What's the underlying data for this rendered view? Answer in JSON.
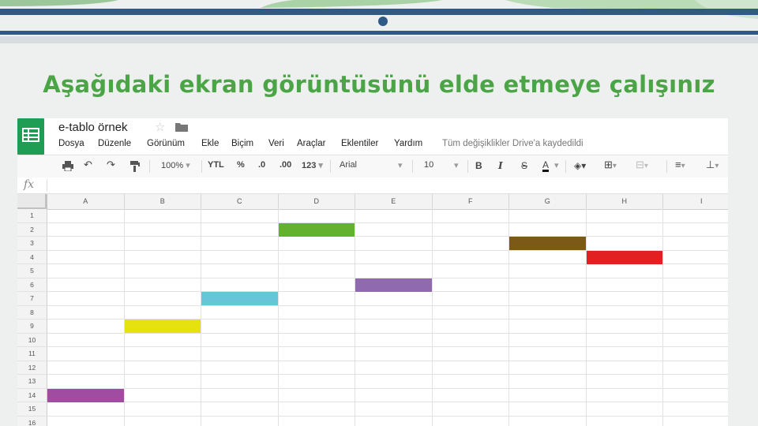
{
  "slide": {
    "title": "Aşağıdaki ekran görüntüsünü elde etmeye çalışınız"
  },
  "doc": {
    "title": "e-tablo örnek",
    "menu": [
      "Dosya",
      "Düzenle",
      "Görünüm",
      "Ekle",
      "Biçim",
      "Veri",
      "Araçlar",
      "Eklentiler",
      "Yardım"
    ],
    "saved_status": "Tüm değişiklikler Drive'a kaydedildi"
  },
  "toolbar": {
    "zoom": "100%",
    "currency": "YTL",
    "percent": "%",
    "dec_decrease": ".0",
    "dec_increase": ".00",
    "format_more": "123",
    "font": "Arial",
    "font_size": "10",
    "bold": "B",
    "italic": "I",
    "strike": "S",
    "text_color": "A"
  },
  "formula_bar": {
    "fx": "fx"
  },
  "grid": {
    "columns": [
      "A",
      "B",
      "C",
      "D",
      "E",
      "F",
      "G",
      "H",
      "I"
    ],
    "rows": [
      "1",
      "2",
      "3",
      "4",
      "5",
      "6",
      "7",
      "8",
      "9",
      "10",
      "11",
      "12",
      "13",
      "14",
      "15",
      "16"
    ],
    "colored_cells": [
      {
        "cell": "D2",
        "color": "#63b22f"
      },
      {
        "cell": "G3",
        "color": "#7b5a17"
      },
      {
        "cell": "H4",
        "color": "#e12121"
      },
      {
        "cell": "E6",
        "color": "#8f6aae"
      },
      {
        "cell": "C7",
        "color": "#67c5d8"
      },
      {
        "cell": "B9",
        "color": "#e5e210"
      },
      {
        "cell": "A14",
        "color": "#a04da1"
      }
    ]
  }
}
